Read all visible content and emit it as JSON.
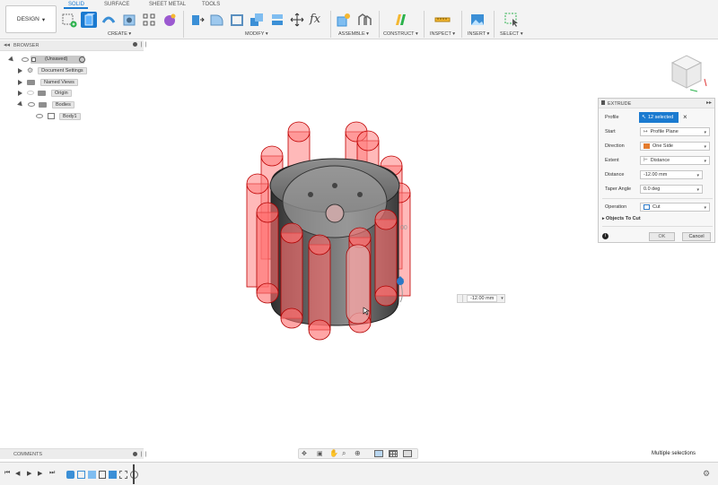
{
  "workspace": {
    "label": "DESIGN"
  },
  "tabs": [
    "SOLID",
    "SURFACE",
    "SHEET METAL",
    "TOOLS"
  ],
  "toolbar_groups": {
    "create": "CREATE ▾",
    "modify": "MODIFY ▾",
    "assemble": "ASSEMBLE ▾",
    "construct": "CONSTRUCT ▾",
    "inspect": "INSPECT ▾",
    "insert": "INSERT ▾",
    "select": "SELECT ▾"
  },
  "browser": {
    "title": "BROWSER",
    "items": [
      {
        "label": "(Unsaved)"
      },
      {
        "label": "Document Settings"
      },
      {
        "label": "Named Views"
      },
      {
        "label": "Origin"
      },
      {
        "label": "Bodies"
      },
      {
        "label": "Body1"
      }
    ]
  },
  "extrude": {
    "title": "EXTRUDE",
    "rows": [
      {
        "label": "Profile",
        "value": "12 selected"
      },
      {
        "label": "Start",
        "value": "Profile Plane"
      },
      {
        "label": "Direction",
        "value": "One Side"
      },
      {
        "label": "Extent",
        "value": "Distance"
      },
      {
        "label": "Distance",
        "value": "-12.00 mm"
      },
      {
        "label": "Taper Angle",
        "value": "0.0 deg"
      },
      {
        "label": "Operation",
        "value": "Cut"
      }
    ],
    "objects_to_cut": "Objects To Cut",
    "ok": "OK",
    "cancel": "Cancel"
  },
  "viewport": {
    "distance_input": "-12.00 mm",
    "dim_label": "00"
  },
  "comments": {
    "title": "COMMENTS"
  },
  "status": {
    "text": "Multiple selections"
  },
  "colors": {
    "accent": "#1a7ad0",
    "cut_fill": "#ff8080",
    "cut_stroke": "#c00000",
    "body": "#4a4a4a"
  }
}
